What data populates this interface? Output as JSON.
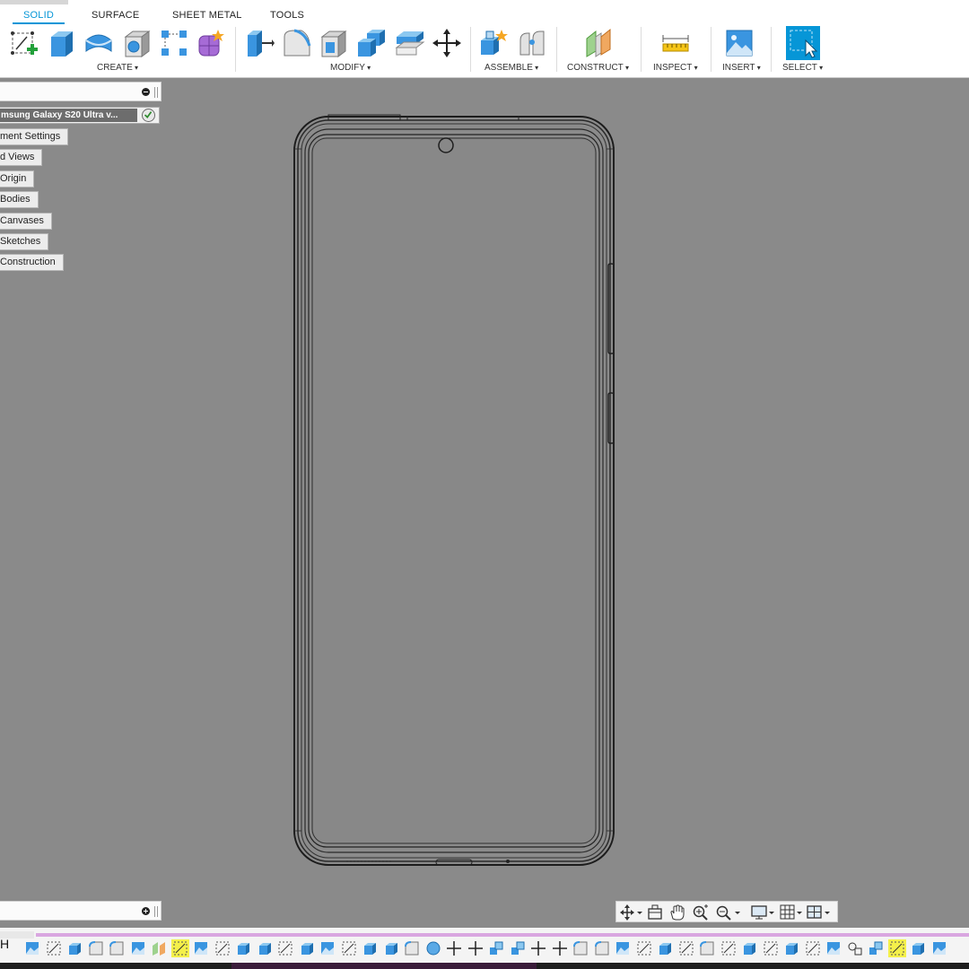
{
  "toolbar": {
    "tabs": [
      {
        "label": "SOLID",
        "active": true
      },
      {
        "label": "SURFACE",
        "active": false
      },
      {
        "label": "SHEET METAL",
        "active": false
      },
      {
        "label": "TOOLS",
        "active": false
      }
    ],
    "groups": {
      "create": "CREATE",
      "modify": "MODIFY",
      "assemble": "ASSEMBLE",
      "construct": "CONSTRUCT",
      "inspect": "INSPECT",
      "insert": "INSERT",
      "select": "SELECT"
    },
    "tools": {
      "create": [
        "create-sketch-icon",
        "extrude-icon",
        "revolve-icon",
        "hole-icon",
        "pattern-icon",
        "create-form-icon"
      ],
      "modify": [
        "press-pull-icon",
        "fillet-icon",
        "shell-icon",
        "combine-icon",
        "offset-face-icon",
        "move-copy-icon"
      ],
      "assemble": [
        "new-component-icon",
        "joint-icon"
      ],
      "construct": [
        "offset-plane-icon"
      ],
      "inspect": [
        "measure-icon"
      ],
      "insert": [
        "insert-image-icon"
      ],
      "select": [
        "select-icon"
      ]
    },
    "accent_color": "#0696d7"
  },
  "browser": {
    "root_label": "msung Galaxy S20 Ultra v...",
    "nodes": [
      "ment Settings",
      "d Views",
      "Origin",
      "Bodies",
      "Canvases",
      "Sketches",
      "Construction"
    ]
  },
  "navigation_bar": {
    "icons": [
      "orbit-icon",
      "look-at-icon",
      "pan-icon",
      "zoom-window-icon",
      "zoom-icon",
      "display-settings-icon",
      "grid-icon",
      "viewports-icon"
    ]
  },
  "timeline": {
    "edge_label": "H",
    "track_color": "#d9a6e0",
    "highlight_color": "#f4f04a"
  }
}
